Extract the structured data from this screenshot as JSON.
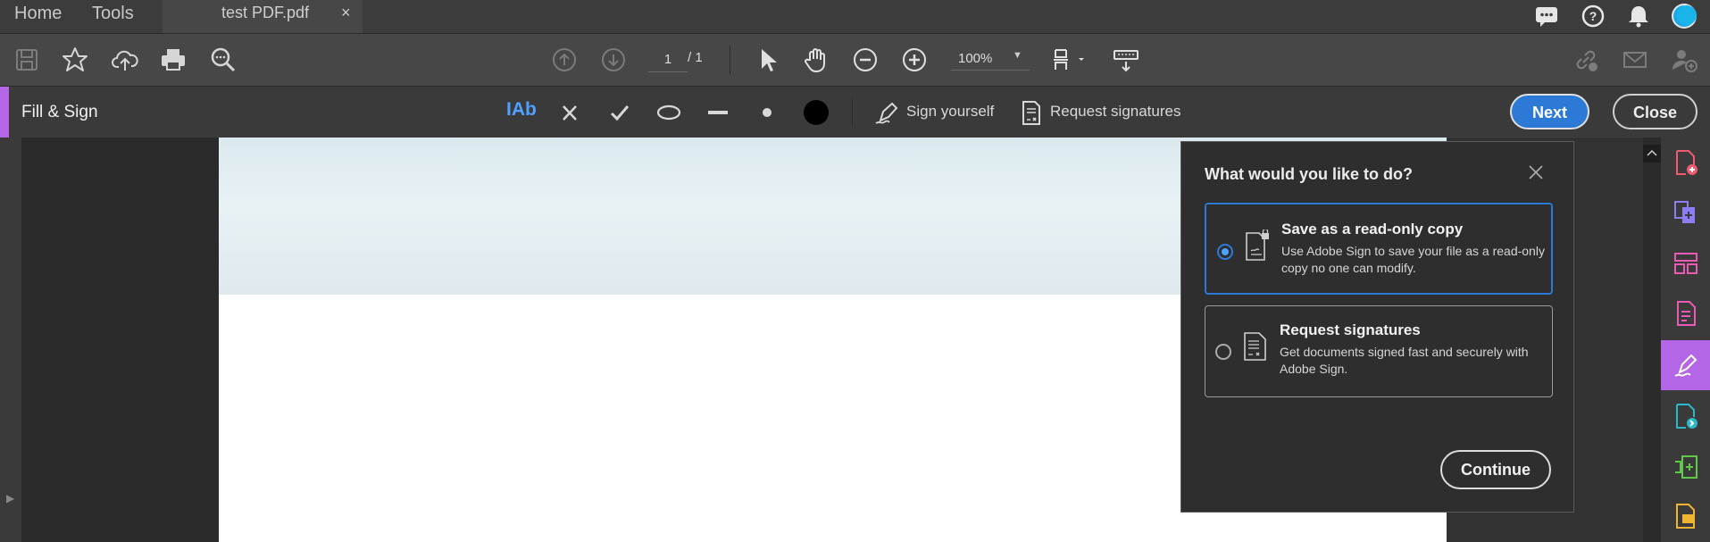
{
  "tabbar": {
    "home_label": "Home",
    "tools_label": "Tools",
    "document_tab": {
      "title": "test PDF.pdf",
      "close": "×"
    }
  },
  "toolbar": {
    "current_page": "1",
    "page_total": "/ 1",
    "zoom": "100%"
  },
  "fill_sign": {
    "title": "Fill & Sign",
    "text_tool": "IAb",
    "sign_yourself": "Sign yourself",
    "request_signatures": "Request signatures",
    "next_label": "Next",
    "close_label": "Close"
  },
  "dialog": {
    "title": "What would you like to do?",
    "options": [
      {
        "title": "Save as a read-only copy",
        "description": "Use Adobe Sign to save your file as a read-only copy no one can modify.",
        "selected": true
      },
      {
        "title": "Request signatures",
        "description": "Get documents signed fast and securely with Adobe Sign.",
        "selected": false
      }
    ],
    "continue_label": "Continue"
  },
  "colors": {
    "accent_purple": "#b366e6",
    "primary_blue": "#2c7ad6",
    "toolbar_bg": "#474747",
    "dialog_bg": "#2e2e2e"
  },
  "icons": {
    "top_right": [
      "chat-icon",
      "help-icon",
      "notifications-icon",
      "avatar"
    ],
    "toolbar_left": [
      "save-icon",
      "star-icon",
      "upload-cloud-icon",
      "print-icon",
      "zoom-search-icon"
    ],
    "toolbar_center": [
      "page-up-icon",
      "page-down-icon",
      "select-arrow-icon",
      "hand-icon",
      "zoom-out-icon",
      "zoom-in-icon",
      "page-fit-icon",
      "keyboard-read-icon"
    ],
    "toolbar_right": [
      "share-link-icon",
      "email-icon",
      "add-user-icon"
    ],
    "right_panel": [
      "create-pdf-icon",
      "combine-files-icon",
      "organize-pages-icon",
      "edit-pdf-icon",
      "fill-sign-icon",
      "export-pdf-icon",
      "compress-icon",
      "comment-icon"
    ]
  }
}
